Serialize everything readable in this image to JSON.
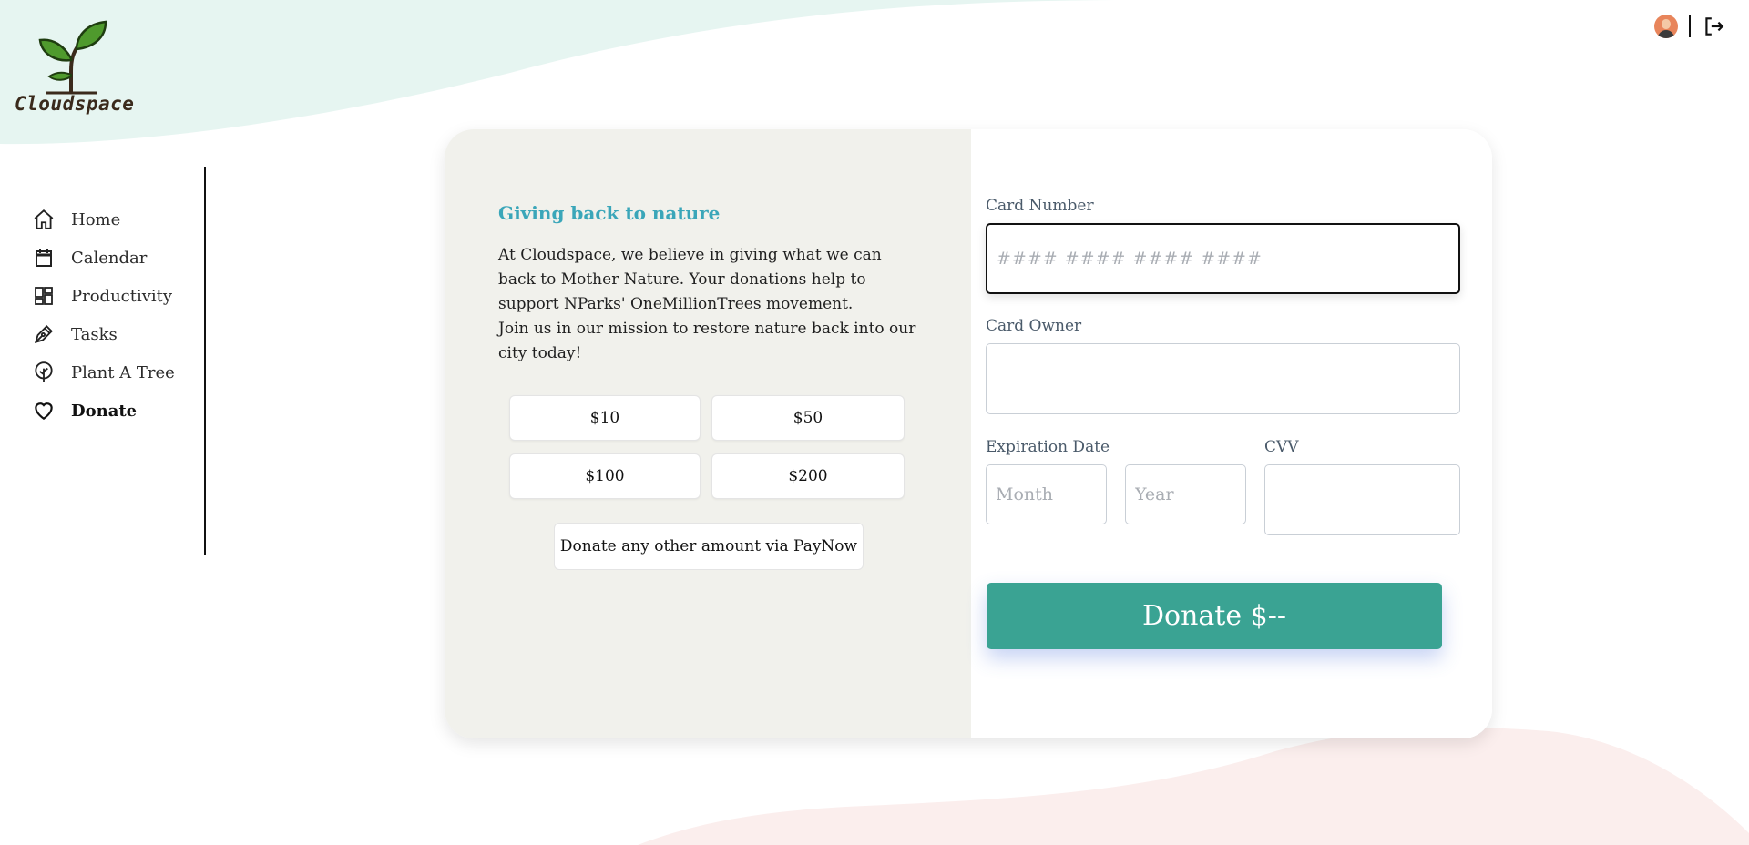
{
  "brand": {
    "name": "Cloudspace"
  },
  "header": {
    "avatar_icon": "user-avatar-icon",
    "logout_icon": "logout-icon"
  },
  "sidebar": {
    "items": [
      {
        "label": "Home",
        "icon": "home-icon",
        "active": false
      },
      {
        "label": "Calendar",
        "icon": "calendar-icon",
        "active": false
      },
      {
        "label": "Productivity",
        "icon": "grid-icon",
        "active": false
      },
      {
        "label": "Tasks",
        "icon": "pen-icon",
        "active": false
      },
      {
        "label": "Plant A Tree",
        "icon": "tree-icon",
        "active": false
      },
      {
        "label": "Donate",
        "icon": "heart-icon",
        "active": true
      }
    ]
  },
  "intro": {
    "title": "Giving back to nature",
    "paragraph1": "At Cloudspace, we believe in giving what we can back to Mother Nature. Your donations help to support NParks' OneMillionTrees movement.",
    "paragraph2": "Join us in our mission to restore nature back into our city today!"
  },
  "amounts": [
    "$10",
    "$50",
    "$100",
    "$200"
  ],
  "paynow_label": "Donate any other amount via PayNow",
  "form": {
    "card_number_label": "Card Number",
    "card_number_placeholder": "#### #### #### ####",
    "card_owner_label": "Card Owner",
    "card_owner_placeholder": "",
    "expiration_label": "Expiration Date",
    "month_placeholder": "Month",
    "year_placeholder": "Year",
    "cvv_label": "CVV",
    "cvv_placeholder": "",
    "donate_label": "Donate $--"
  },
  "colors": {
    "accent": "#3aa393",
    "title": "#3aa6b9",
    "top_wave": "#e6f5f1",
    "bottom_wave": "#fbeeed",
    "card_left_bg": "#f1f1ec"
  }
}
